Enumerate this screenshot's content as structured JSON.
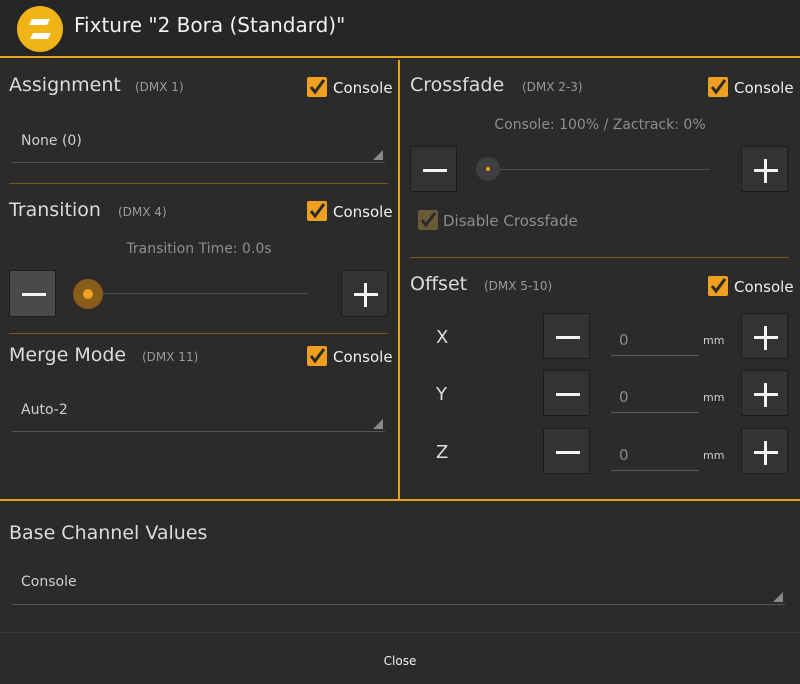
{
  "title": "Fixture \"2 Bora (Standard)\"",
  "assignment": {
    "title": "Assignment",
    "dmx": "(DMX 1)",
    "console_label": "Console",
    "select_value": "None (0)"
  },
  "transition": {
    "title": "Transition",
    "dmx": "(DMX 4)",
    "console_label": "Console",
    "time_text": "Transition Time: 0.0s",
    "slider_value": 0
  },
  "merge_mode": {
    "title": "Merge Mode",
    "dmx": "(DMX 11)",
    "console_label": "Console",
    "select_value": "Auto-2"
  },
  "crossfade": {
    "title": "Crossfade",
    "dmx": "(DMX 2-3)",
    "console_label": "Console",
    "ratio_text": "Console: 100% / Zactrack: 0%",
    "slider_value": 0,
    "disable_label": "Disable Crossfade"
  },
  "offset": {
    "title": "Offset",
    "dmx": "(DMX 5-10)",
    "console_label": "Console",
    "unit": "mm",
    "axes": [
      {
        "label": "X",
        "value": "0"
      },
      {
        "label": "Y",
        "value": "0"
      },
      {
        "label": "Z",
        "value": "0"
      }
    ]
  },
  "base_channel": {
    "title": "Base Channel Values",
    "select_value": "Console"
  },
  "close_label": "Close",
  "colors": {
    "accent": "#e9a31b",
    "logo": "#f0b417",
    "background": "#2b2b2b"
  },
  "icons": [
    "app-logo-icon",
    "checkbox-checked-icon",
    "minus-icon",
    "plus-icon",
    "dropdown-triangle-icon"
  ]
}
